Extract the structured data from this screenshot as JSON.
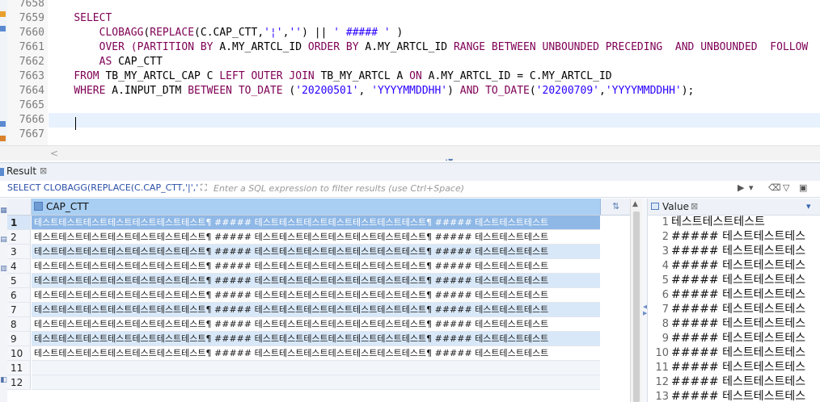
{
  "editor": {
    "lines": [
      {
        "num": "7658",
        "parts": []
      },
      {
        "num": "7659",
        "parts": [
          {
            "t": "    "
          },
          {
            "t": "SELECT",
            "c": "kw"
          }
        ]
      },
      {
        "num": "7660",
        "parts": [
          {
            "t": "        "
          },
          {
            "t": "CLOBAGG",
            "c": "kw"
          },
          {
            "t": "("
          },
          {
            "t": "REPLACE",
            "c": "kw"
          },
          {
            "t": "(C.CAP_CTT,"
          },
          {
            "t": "'¦'",
            "c": "str"
          },
          {
            "t": ","
          },
          {
            "t": "''",
            "c": "str"
          },
          {
            "t": ") || "
          },
          {
            "t": "' ##### '",
            "c": "str"
          },
          {
            "t": " )"
          }
        ]
      },
      {
        "num": "7661",
        "parts": [
          {
            "t": "        "
          },
          {
            "t": "OVER (PARTITION BY",
            "c": "kw"
          },
          {
            "t": " A.MY_ARTCL_ID "
          },
          {
            "t": "ORDER BY",
            "c": "kw"
          },
          {
            "t": " A.MY_ARTCL_ID "
          },
          {
            "t": "RANGE BETWEEN UNBOUNDED PRECEDING  AND UNBOUNDED  FOLLOW",
            "c": "kw"
          }
        ]
      },
      {
        "num": "7662",
        "parts": [
          {
            "t": "        "
          },
          {
            "t": "AS",
            "c": "kw"
          },
          {
            "t": " CAP_CTT"
          }
        ]
      },
      {
        "num": "7663",
        "parts": [
          {
            "t": "    "
          },
          {
            "t": "FROM",
            "c": "kw"
          },
          {
            "t": " TB_MY_ARTCL_CAP C "
          },
          {
            "t": "LEFT OUTER JOIN",
            "c": "kw"
          },
          {
            "t": " TB_MY_ARTCL A "
          },
          {
            "t": "ON",
            "c": "kw"
          },
          {
            "t": " A.MY_ARTCL_ID = C.MY_ARTCL_ID"
          }
        ]
      },
      {
        "num": "7664",
        "parts": [
          {
            "t": "    "
          },
          {
            "t": "WHERE",
            "c": "kw"
          },
          {
            "t": " A.INPUT_DTM "
          },
          {
            "t": "BETWEEN TO_DATE",
            "c": "kw"
          },
          {
            "t": " ("
          },
          {
            "t": "'20200501'",
            "c": "str"
          },
          {
            "t": ", "
          },
          {
            "t": "'YYYYMMDDHH'",
            "c": "str"
          },
          {
            "t": ") "
          },
          {
            "t": "AND TO_DATE",
            "c": "kw"
          },
          {
            "t": "("
          },
          {
            "t": "'20200709'",
            "c": "str"
          },
          {
            "t": ","
          },
          {
            "t": "'YYYYMMDDHH'",
            "c": "str"
          },
          {
            "t": ");"
          }
        ]
      },
      {
        "num": "7665",
        "parts": []
      },
      {
        "num": "7666",
        "parts": []
      },
      {
        "num": "7667",
        "parts": []
      }
    ],
    "current_line": 8
  },
  "result": {
    "tab_label": "Result",
    "close_glyph": "⊠",
    "sql_label": "SELECT CLOBAGG(REPLACE(C.CAP_CTT,'|','",
    "filter_placeholder": "Enter a SQL expression to filter results (use Ctrl+Space)",
    "column": "CAP_CTT",
    "rows": [
      {
        "num": "1",
        "value": "테스트테스트테스트테스트테스트테스트테스트¶ ##### 테스트테스트테스트테스트테스트테스트테스트¶ ##### 테스트테스트테스트"
      },
      {
        "num": "2",
        "value": "테스트테스트테스트테스트테스트테스트테스트¶ ##### 테스트테스트테스트테스트테스트테스트테스트¶ ##### 테스트테스트테스트"
      },
      {
        "num": "3",
        "value": "테스트테스트테스트테스트테스트테스트테스트¶ ##### 테스트테스트테스트테스트테스트테스트테스트¶ ##### 테스트테스트테스트"
      },
      {
        "num": "4",
        "value": "테스트테스트테스트테스트테스트테스트테스트¶ ##### 테스트테스트테스트테스트테스트테스트테스트¶ ##### 테스트테스트테스트"
      },
      {
        "num": "5",
        "value": "테스트테스트테스트테스트테스트테스트테스트¶ ##### 테스트테스트테스트테스트테스트테스트테스트¶ ##### 테스트테스트테스트"
      },
      {
        "num": "6",
        "value": "테스트테스트테스트테스트테스트테스트테스트¶ ##### 테스트테스트테스트테스트테스트테스트테스트¶ ##### 테스트테스트테스트"
      },
      {
        "num": "7",
        "value": "테스트테스트테스트테스트테스트테스트테스트¶ ##### 테스트테스트테스트테스트테스트테스트테스트¶ ##### 테스트테스트테스트"
      },
      {
        "num": "8",
        "value": "테스트테스트테스트테스트테스트테스트테스트¶ ##### 테스트테스트테스트테스트테스트테스트테스트¶ ##### 테스트테스트테스트"
      },
      {
        "num": "9",
        "value": "테스트테스트테스트테스트테스트테스트테스트¶ ##### 테스트테스트테스트테스트테스트테스트테스트¶ ##### 테스트테스트테스트"
      },
      {
        "num": "10",
        "value": "테스트테스트테스트테스트테스트테스트테스트¶ ##### 테스트테스트테스트테스트테스트테스트테스트¶ ##### 테스트테스트테스트"
      },
      {
        "num": "11",
        "value": ""
      },
      {
        "num": "12",
        "value": ""
      }
    ],
    "selected_row": 0
  },
  "value_panel": {
    "tab_label": "Value",
    "close_glyph": "⊠",
    "lines": [
      {
        "num": "1",
        "text": "테스트테스트테스트"
      },
      {
        "num": "2",
        "text": "##### 테스트테스트테스"
      },
      {
        "num": "3",
        "text": "##### 테스트테스트테스"
      },
      {
        "num": "4",
        "text": "##### 테스트테스트테스"
      },
      {
        "num": "5",
        "text": "##### 테스트테스트테스"
      },
      {
        "num": "6",
        "text": "##### 테스트테스트테스"
      },
      {
        "num": "7",
        "text": "##### 테스트테스트테스"
      },
      {
        "num": "8",
        "text": "##### 테스트테스트테스"
      },
      {
        "num": "9",
        "text": "##### 테스트테스트테스"
      },
      {
        "num": "10",
        "text": "##### 테스트테스트테스"
      },
      {
        "num": "11",
        "text": "##### 테스트테스트테스"
      },
      {
        "num": "12",
        "text": "##### 테스트테스트테스"
      },
      {
        "num": "13",
        "text": "##### 테스트테스트테스"
      }
    ]
  },
  "colors": {
    "keyword": "#7f0055",
    "string": "#2a00ff",
    "selected_row": "#8fb8e6",
    "alt_row": "#d8e8f8"
  }
}
